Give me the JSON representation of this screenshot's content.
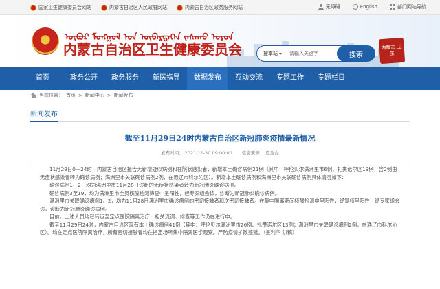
{
  "topbar": {
    "links": [
      "国家卫生健康委员会网站",
      "内蒙古自治区人民政府网站",
      "内蒙古自治区政务服务网站"
    ],
    "right": [
      "无障碍",
      "English",
      "部门网站导航"
    ]
  },
  "header": {
    "mongolian_title": "ᠥᠪᠥᠷ ᠮᠣᠩᠭᠣᠯ ᠤᠨ ᠥᠪᠡᠷᠲᠡᠭᠡᠨ ᠵᠠᠰᠠᠬᠤ ᠣᠷᠤᠨ",
    "title": "内蒙古自治区卫生健康委员会",
    "search_scope": "搜本站",
    "search_placeholder": "请输入关键字",
    "search_button": "搜索",
    "seal_text": "内蒙古 卫生"
  },
  "nav": [
    "首页",
    "政务公开",
    "政务服务",
    "新医指导",
    "数据发布",
    "互动交流",
    "专题工作",
    "专题栏目"
  ],
  "nav_active_index": 4,
  "breadcrumb": {
    "label": "当前位置：",
    "items": [
      "首页",
      "新闻中心",
      "新闻发布"
    ]
  },
  "section_title": "新闻发布",
  "article": {
    "title": "截至11月29日24时内蒙古自治区新冠肺炎疫情最新情况",
    "time": "发布时间： 2021-11-30 09:00:00",
    "source": "信息来源： 应急办",
    "paragraphs": [
      "11月29日0－24时，内蒙古自治区报告无新增疑似病例和在院状感染者，新增本土确诊病例21例（其中：呼伦贝尔满洲里市6例、扎赉诺尔区13例，含2例由无症状感染者转为确诊病例；满洲里市关联确诊病例2例，在通辽市科尔沁区）。新增本土确诊病例和满洲里市关联确诊病例具体情况如下：",
      "确诊病例1、2，均为满洲里市11月28日诊断的无症状感染者转为新冠肺炎确诊病例。",
      "确诊病例3至19，均为满洲里市全员核酸检测筛查中呈阳性，经专家组会诊，诊断为新冠肺炎确诊病例。",
      "满洲里市关联确诊病例1、2，均为11月28日满洲里市确诊病例的密切接触者和次密切接触者。在集中隔离期间核酸检测中呈阳性，经复核呈阳性，经专家组会诊，诊断为新冠肺炎确诊病例。",
      "目前，上述人员均已转运至定点医院隔离治疗，相关流调、排查等工作仍在进行中。",
      "截至11月29日24时，内蒙古自治区现有本土确诊病例41例（其中：呼伦贝尔满洲里市26例、扎赉诺尔区13例；满洲里市关联确诊病例2例，在通辽市科尔沁区）。均在定点医院隔离治疗，所有密切接触者均在指定场所集中隔离医学观察。严防疫情扩散蔓延。（呈利华 供稿）"
    ]
  }
}
